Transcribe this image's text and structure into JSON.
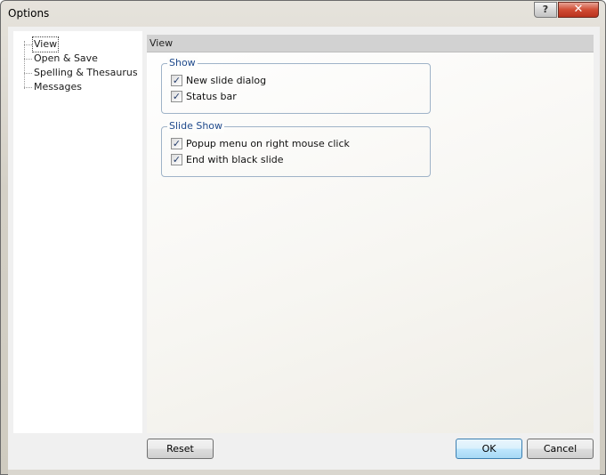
{
  "window": {
    "title": "Options",
    "help_label": "?",
    "close_label": "✕"
  },
  "tree": {
    "items": [
      {
        "label": "View",
        "selected": true
      },
      {
        "label": "Open & Save",
        "selected": false
      },
      {
        "label": "Spelling & Thesaurus",
        "selected": false
      },
      {
        "label": "Messages",
        "selected": false
      }
    ]
  },
  "panel": {
    "header": "View",
    "groups": [
      {
        "title": "Show",
        "options": [
          {
            "label": "New slide dialog",
            "checked": true
          },
          {
            "label": "Status bar",
            "checked": true
          }
        ]
      },
      {
        "title": "Slide Show",
        "options": [
          {
            "label": "Popup menu on right mouse click",
            "checked": true
          },
          {
            "label": "End with black slide",
            "checked": true
          }
        ]
      }
    ]
  },
  "buttons": {
    "reset": "Reset",
    "ok": "OK",
    "cancel": "Cancel"
  },
  "colors": {
    "group_title": "#1f4a8c",
    "close_button": "#c8442d",
    "default_button_border": "#3c7fb1"
  }
}
